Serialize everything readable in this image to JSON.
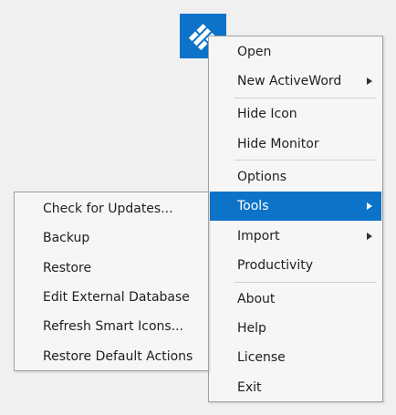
{
  "colors": {
    "accent": "#0d73c8",
    "menu_background": "#f6f6f6",
    "menu_border": "#a0a0a0",
    "text": "#1e1e1e",
    "page_background": "#f0f0f0"
  },
  "app_icon": {
    "icon": "activewords-logo-icon"
  },
  "main_menu": {
    "items": [
      {
        "label": "Open",
        "has_submenu": false
      },
      {
        "label": "New ActiveWord",
        "has_submenu": true
      },
      {
        "label": "Hide Icon",
        "has_submenu": false
      },
      {
        "label": "Hide Monitor",
        "has_submenu": false
      },
      {
        "label": "Options",
        "has_submenu": false
      },
      {
        "label": "Tools",
        "has_submenu": true,
        "highlighted": true
      },
      {
        "label": "Import",
        "has_submenu": true
      },
      {
        "label": "Productivity",
        "has_submenu": false
      },
      {
        "label": "About",
        "has_submenu": false
      },
      {
        "label": "Help",
        "has_submenu": false
      },
      {
        "label": "License",
        "has_submenu": false
      },
      {
        "label": "Exit",
        "has_submenu": false
      }
    ]
  },
  "tools_submenu": {
    "items": [
      {
        "label": "Check for Updates..."
      },
      {
        "label": "Backup"
      },
      {
        "label": "Restore"
      },
      {
        "label": "Edit External Database"
      },
      {
        "label": "Refresh Smart Icons..."
      },
      {
        "label": "Restore Default Actions"
      }
    ]
  }
}
